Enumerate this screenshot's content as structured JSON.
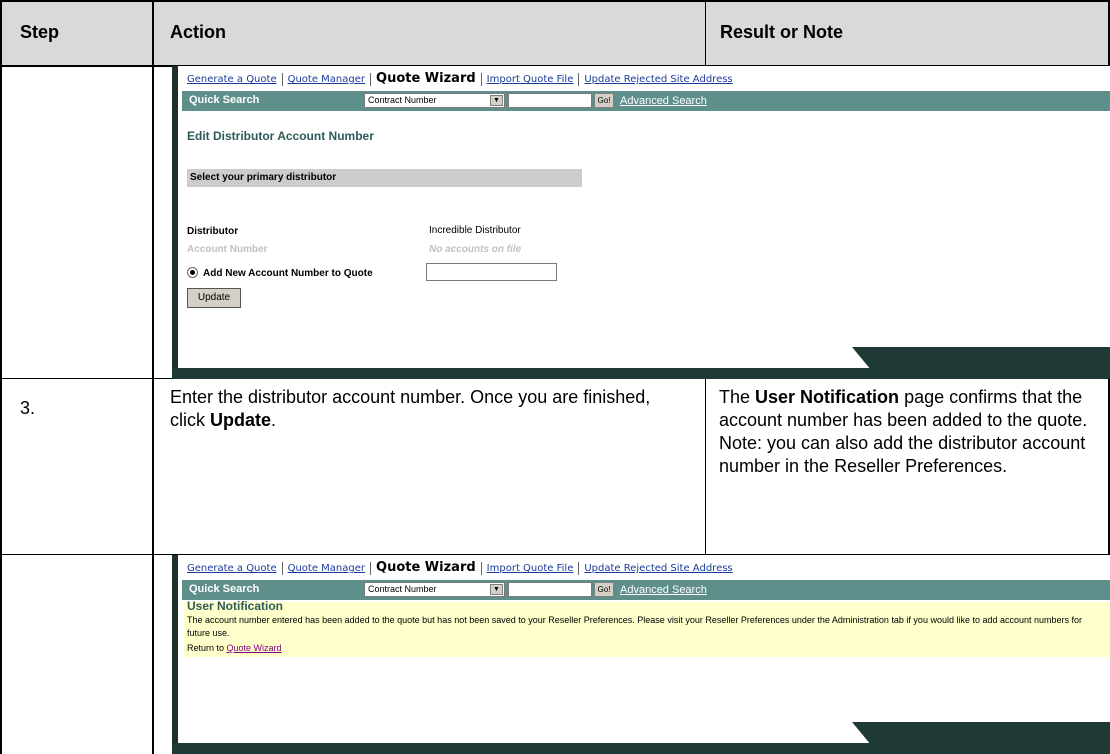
{
  "table": {
    "headers": {
      "step": "Step",
      "action": "Action",
      "result": "Result or Note"
    },
    "row3": {
      "step": "3.",
      "action_pre": "Enter the distributor account number. Once you are finished, click ",
      "action_bold": "Update",
      "action_post": ".",
      "result_pre": "The ",
      "result_bold": "User Notification",
      "result_post": " page confirms that the account number has been added to the quote. Note: you can also add the distributor account number in the Reseller Preferences."
    }
  },
  "nav": {
    "generate": "Generate a Quote",
    "manager": "Quote Manager",
    "wizard": "Quote Wizard",
    "import": "Import Quote File",
    "update_rejected": "Update Rejected Site Address"
  },
  "quick_search": {
    "label": "Quick Search",
    "select_value": "Contract Number",
    "go": "Go!",
    "advanced": "Advanced Search"
  },
  "shot1": {
    "title": "Edit Distributor Account Number",
    "section": "Select your primary distributor",
    "distributor_label": "Distributor",
    "distributor_value": "Incredible Distributor",
    "account_label": "Account Number",
    "account_value": "No accounts on file",
    "add_label": "Add New Account Number to Quote",
    "update_button": "Update"
  },
  "shot2": {
    "title": "User Notification",
    "message": "The account number entered has been added to the quote but has not been saved to your Reseller Preferences. Please visit your Reseller Preferences under the Administration tab if you would like to add account numbers for future use.",
    "return_text": "Return to ",
    "return_link": "Quote Wizard"
  }
}
